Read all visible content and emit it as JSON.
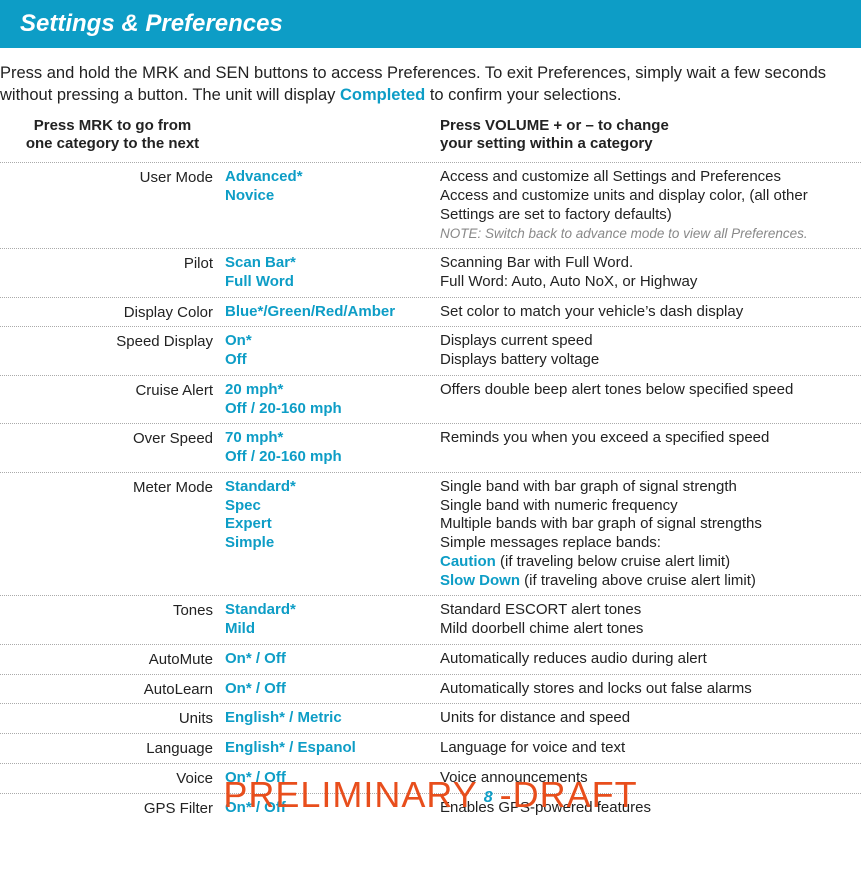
{
  "header": {
    "title": "Settings & Preferences"
  },
  "intro": {
    "text_before": "Press and hold the MRK and SEN buttons to access Preferences. To exit Preferences, simply wait a few seconds without pressing a button. The unit will display ",
    "completed_word": "Completed",
    "text_after": " to confirm your selections."
  },
  "col_heads": {
    "left_l1": "Press MRK to go from",
    "left_l2": "one category to the next",
    "right_l1": "Press VOLUME + or – to change",
    "right_l2": "your setting within a category"
  },
  "rows": [
    {
      "category": "User Mode",
      "options": [
        "Advanced*",
        "Novice"
      ],
      "desc": [
        "Access and customize all Settings and Preferences",
        "Access and customize units and display color, (all other Settings are set to factory defaults)"
      ],
      "note": "NOTE: Switch back to advance mode to view all Preferences."
    },
    {
      "category": "Pilot",
      "options": [
        "Scan Bar*",
        "Full Word"
      ],
      "desc": [
        "Scanning Bar with Full Word.",
        "Full Word: Auto, Auto NoX, or Highway"
      ]
    },
    {
      "category": "Display Color",
      "options": [
        "Blue*/Green/Red/Amber"
      ],
      "desc": [
        "Set color to match your vehicle’s dash display"
      ]
    },
    {
      "category": "Speed Display",
      "options": [
        "On*",
        "Off"
      ],
      "desc": [
        "Displays current speed",
        "Displays battery voltage"
      ]
    },
    {
      "category": "Cruise Alert",
      "options": [
        "20 mph*",
        "Off / 20-160 mph"
      ],
      "desc": [
        "Offers double beep alert tones below specified speed"
      ]
    },
    {
      "category": "Over Speed",
      "options": [
        "70 mph*",
        "Off / 20-160 mph"
      ],
      "desc": [
        "Reminds you when you exceed a specified speed"
      ]
    },
    {
      "category": "Meter Mode",
      "options": [
        "Standard*",
        "Spec",
        "Expert",
        "Simple"
      ],
      "desc": [
        "Single band with bar graph of signal strength",
        "Single band with numeric frequency",
        "Multiple bands with bar graph of signal strengths",
        "Simple messages replace bands:"
      ],
      "extra": [
        {
          "key": "Caution",
          "text": " (if traveling below cruise alert limit)"
        },
        {
          "key": "Slow Down",
          "text": " (if traveling above cruise alert limit)"
        }
      ]
    },
    {
      "category": "Tones",
      "options": [
        "Standard*",
        "Mild"
      ],
      "desc": [
        "Standard ESCORT alert tones",
        "Mild doorbell chime alert tones"
      ]
    },
    {
      "category": "AutoMute",
      "options": [
        "On* / Off"
      ],
      "desc": [
        "Automatically reduces audio during alert"
      ]
    },
    {
      "category": "AutoLearn",
      "options": [
        "On* / Off"
      ],
      "desc": [
        "Automatically stores and locks out false alarms"
      ]
    },
    {
      "category": "Units",
      "options": [
        "English* / Metric"
      ],
      "desc": [
        "Units for distance and speed"
      ]
    },
    {
      "category": "Language",
      "options": [
        "English* / Espanol"
      ],
      "desc": [
        "Language for voice and text"
      ]
    },
    {
      "category": "Voice",
      "options": [
        "On* / Off"
      ],
      "desc": [
        "Voice announcements"
      ]
    },
    {
      "category": "GPS Filter",
      "options": [
        "On* / Off"
      ],
      "desc": [
        "Enables GPS-powered features"
      ]
    }
  ],
  "watermark": {
    "left": "PRELIMINARY",
    "page": "8",
    "right": "-DRAFT"
  }
}
